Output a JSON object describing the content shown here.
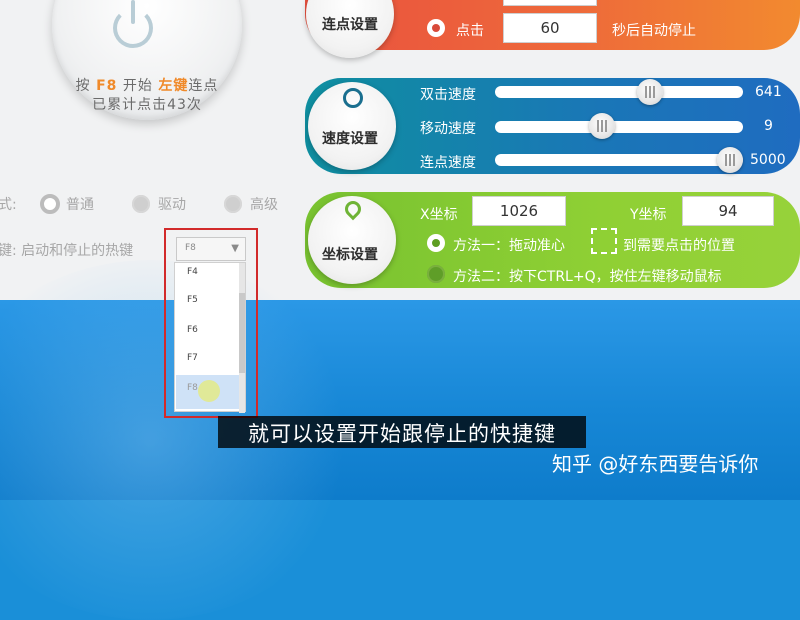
{
  "main_button": {
    "hint_prefix": "按",
    "hint_key": "F8",
    "hint_mid": "开始",
    "hint_button": "左键",
    "hint_suffix": "连点",
    "count_text": "已累计点击43次"
  },
  "mode": {
    "label": "式:",
    "options": [
      "普通",
      "驱动",
      "高级"
    ],
    "selected": "普通"
  },
  "hotkey": {
    "label": "键: 启动和停止的热键",
    "selected": "F8",
    "options": [
      "F4",
      "F5",
      "F6",
      "F7",
      "F8"
    ],
    "hovered": "F8"
  },
  "click_settings": {
    "title": "连点设置",
    "mode_label": "点击",
    "seconds": "60",
    "suffix": "秒后自动停止"
  },
  "speed_settings": {
    "title": "速度设置",
    "sliders": [
      {
        "label": "双击速度",
        "value": 641,
        "max": 1000
      },
      {
        "label": "移动速度",
        "value": 9,
        "max": 100
      },
      {
        "label": "连点速度",
        "value": 5000,
        "max": 5000
      }
    ]
  },
  "coord_settings": {
    "title": "坐标设置",
    "x_label": "X坐标",
    "x_value": "1026",
    "y_label": "Y坐标",
    "y_value": "94",
    "method1": "方法一：拖动准心",
    "method1_tail": "到需要点击的位置",
    "method2": "方法二：按下CTRL+Q，按住左键移动鼠标"
  },
  "subtitle": "就可以设置开始跟停止的快捷键",
  "watermark": "知乎 @好东西要告诉你"
}
